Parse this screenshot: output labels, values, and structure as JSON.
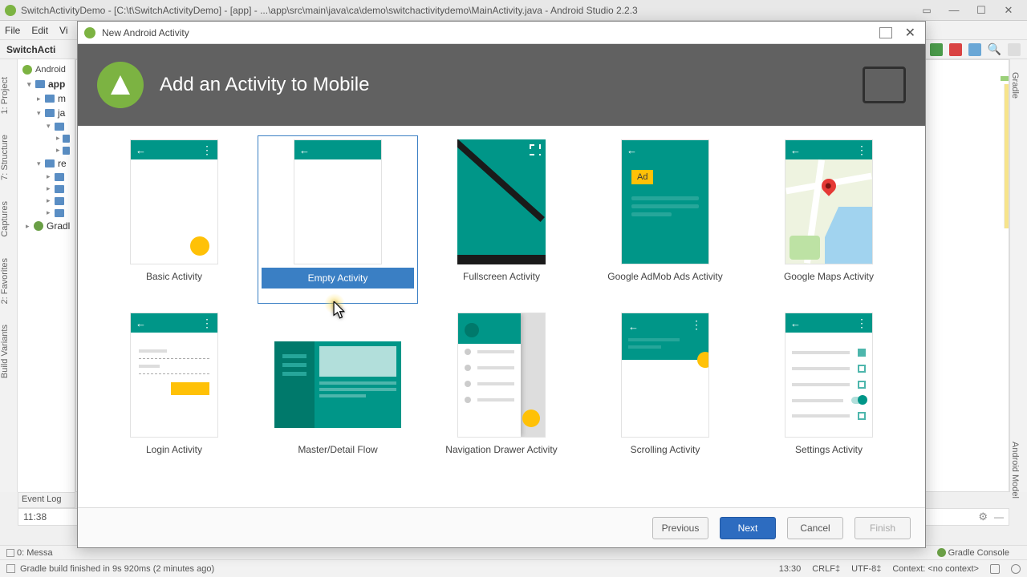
{
  "window": {
    "title": "SwitchActivityDemo - [C:\\t\\SwitchActivityDemo] - [app] - ...\\app\\src\\main\\java\\ca\\demo\\switchactivitydemo\\MainActivity.java - Android Studio 2.2.3"
  },
  "menubar": [
    "File",
    "Edit",
    "Vi"
  ],
  "left_strip": [
    "1: Project",
    "7: Structure",
    "Captures",
    "2: Favorites",
    "Build Variants"
  ],
  "right_strip": [
    "Gradle",
    "Android Model"
  ],
  "project": {
    "header": "Android",
    "items": [
      "app",
      "m",
      "ja",
      "re",
      "Gradl"
    ]
  },
  "breadcrumb": {
    "left": "SwitchActi"
  },
  "event_log": {
    "tab": "Event Log",
    "line_prefix": "11:38"
  },
  "bottom_tabs": {
    "messages": "0: Messa",
    "gradle_console": "Gradle Console"
  },
  "statusbar": {
    "message": "Gradle build finished in 9s 920ms (2 minutes ago)",
    "right": [
      "13:30",
      "CRLF‡",
      "UTF-8‡",
      "Context: <no context>"
    ]
  },
  "dialog": {
    "title": "New Android Activity",
    "header": "Add an Activity to Mobile",
    "templates_row1": [
      "Basic Activity",
      "Empty Activity",
      "Fullscreen Activity",
      "Google AdMob Ads Activity",
      "Google Maps Activity"
    ],
    "templates_row2": [
      "Login Activity",
      "Master/Detail Flow",
      "Navigation Drawer Activity",
      "Scrolling Activity",
      "Settings Activity"
    ],
    "ad_label": "Ad",
    "buttons": {
      "previous": "Previous",
      "next": "Next",
      "cancel": "Cancel",
      "finish": "Finish"
    }
  }
}
